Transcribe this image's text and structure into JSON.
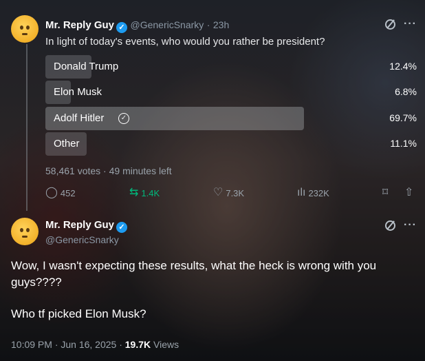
{
  "tweet1": {
    "display_name": "Mr. Reply Guy",
    "handle": "@GenericSnarky",
    "separator": "·",
    "time": "23h",
    "text": "In light of today's events, who would you rather be president?",
    "poll": {
      "options": [
        {
          "label": "Donald Trump",
          "percent": "12.4%",
          "share": 0.124,
          "winner": false
        },
        {
          "label": "Elon Musk",
          "percent": "6.8%",
          "share": 0.068,
          "winner": false
        },
        {
          "label": "Adolf Hitler",
          "percent": "69.7%",
          "share": 0.697,
          "winner": true
        },
        {
          "label": "Other",
          "percent": "11.1%",
          "share": 0.111,
          "winner": false
        }
      ],
      "meta": "58,461 votes · 49 minutes left"
    },
    "actions": {
      "replies": "452",
      "reposts": "1.4K",
      "likes": "7.3K",
      "views": "232K"
    }
  },
  "tweet2": {
    "display_name": "Mr. Reply Guy",
    "handle": "@GenericSnarky",
    "paragraphs": [
      "Wow, I wasn't expecting these results, what the heck is wrong with you guys????",
      "Who tf picked Elon Musk?"
    ],
    "timestamp": "10:09 PM · Jun 16, 2025 · ",
    "views_count": "19.7K",
    "views_label": " Views"
  },
  "icons": {
    "verified": "verified-badge-icon",
    "grok": "grok-icon",
    "more": "more-icon",
    "reply": "reply-icon",
    "repost": "repost-icon",
    "like": "like-icon",
    "views": "views-icon",
    "bookmark": "bookmark-icon",
    "share": "share-icon"
  },
  "colors": {
    "verified": "#1d9bf0",
    "repost_active": "#00ba7c",
    "secondary_text": "#9aa3ab"
  }
}
